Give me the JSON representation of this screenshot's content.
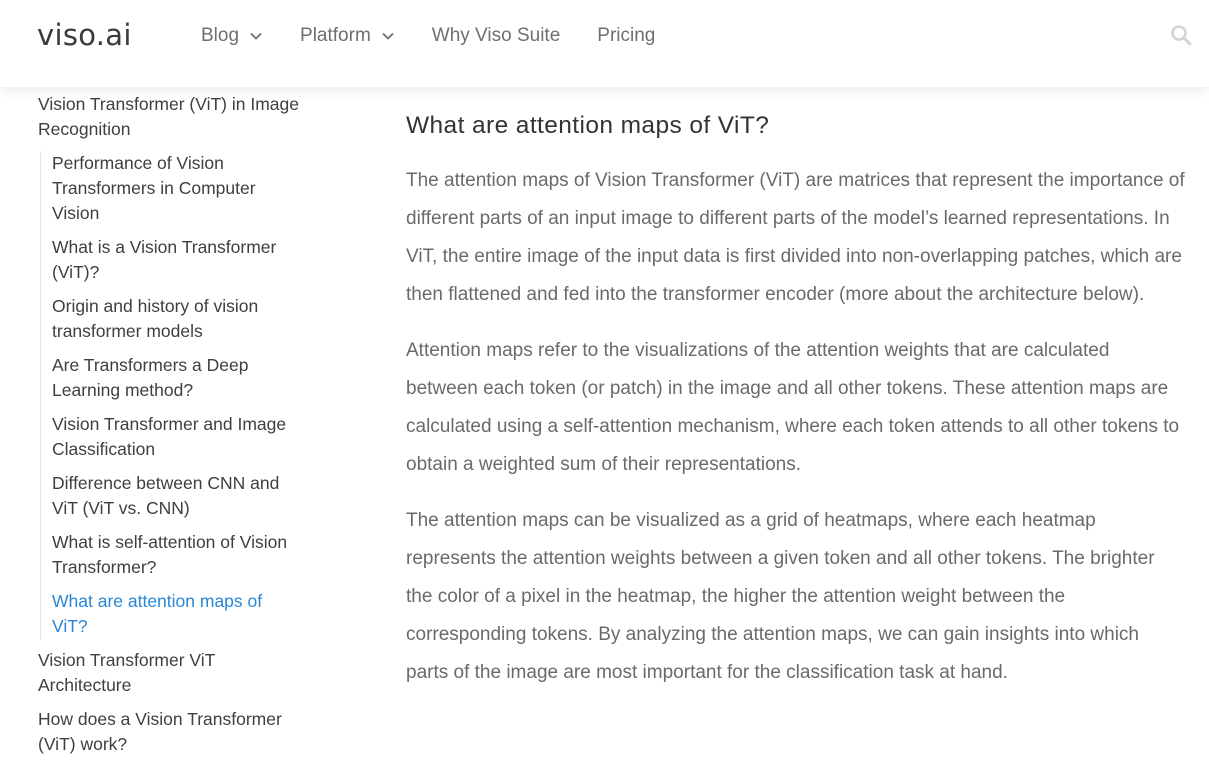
{
  "header": {
    "logo": "viso.ai",
    "nav": [
      {
        "label": "Blog",
        "has_dropdown": true
      },
      {
        "label": "Platform",
        "has_dropdown": true
      },
      {
        "label": "Why Viso Suite",
        "has_dropdown": false
      },
      {
        "label": "Pricing",
        "has_dropdown": false
      }
    ],
    "search_icon": "search-icon"
  },
  "toc": {
    "top_item": "Vision Transformer (ViT) in Image Recognition",
    "sub_items": [
      "Performance of Vision Transformers in Computer Vision",
      "What is a Vision Transformer (ViT)?",
      "Origin and history of vision transformer models",
      "Are Transformers a Deep Learning method?",
      "Vision Transformer and Image Classification",
      "Difference between CNN and ViT (ViT vs. CNN)",
      "What is self-attention of Vision Transformer?",
      "What are attention maps of ViT?"
    ],
    "active_index": 7,
    "after_items": [
      "Vision Transformer ViT Architecture",
      "How does a Vision Transformer (ViT) work?"
    ]
  },
  "article": {
    "title": "What are attention maps of ViT?",
    "paragraphs": [
      "The attention maps of Vision Transformer (ViT) are matrices that represent the importance of different parts of an input image to different parts of the model’s learned representations. In ViT, the entire image of the input data is first divided into non-overlapping patches, which are then flattened and fed into the transformer encoder (more about the architecture below).",
      "Attention maps refer to the visualizations of the attention weights that are calculated between each token (or patch) in the image and all other tokens. These attention maps are calculated using a self-attention mechanism, where each token attends to all other tokens to obtain a weighted sum of their representations.",
      "The attention maps can be visualized as a grid of heatmaps, where each heatmap represents the attention weights between a given token and all other tokens. The brighter the color of a pixel in the heatmap, the higher the attention weight between the corresponding tokens. By analyzing the attention maps, we can gain insights into which parts of the image are most important for the classification task at hand."
    ]
  },
  "colors": {
    "accent_link": "#2a86d6",
    "body_text": "#6a6a6a",
    "heading": "#333333",
    "nav_text": "#6f6f6f"
  }
}
